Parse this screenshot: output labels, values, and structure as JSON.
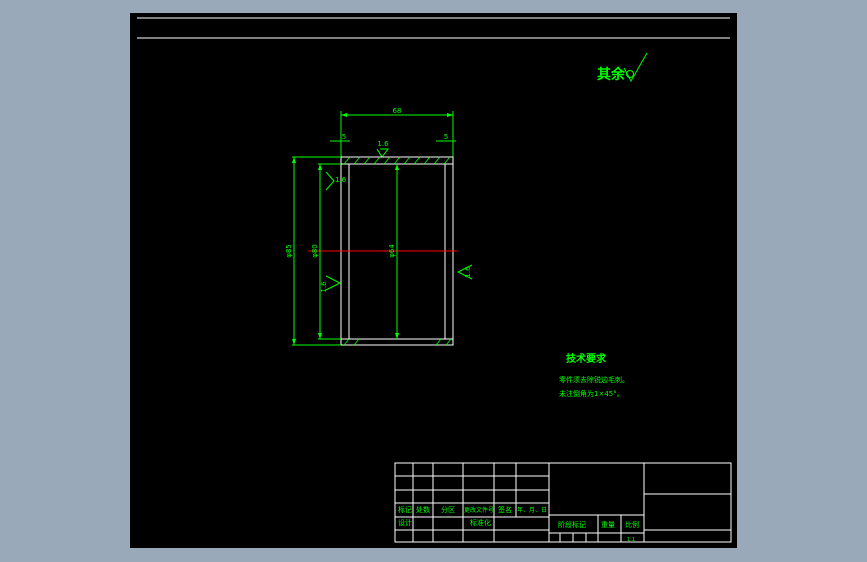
{
  "colors": {
    "background": "#99a9b9",
    "viewport": "#000000",
    "frame": "#ffffff",
    "geometry": "#ffffff",
    "dimension": "#00ff00",
    "centerline": "#ff0000",
    "hatch": "#00ff00"
  },
  "roughness_note": {
    "label": "其余",
    "symbol": "roughness-check-icon"
  },
  "dimensions": {
    "overall_width": "68",
    "left_flange": "5",
    "right_flange": "5",
    "outer_height": "φ85",
    "mid_height": "φ80",
    "bore": "φ64"
  },
  "roughness_marks": {
    "top": "1.6",
    "left_upper": "1.6",
    "left_lower": "1.6",
    "right": "1.6"
  },
  "tech_requirements": {
    "title": "技术要求",
    "lines": [
      "零件须去除锐边毛刺。",
      "未注倒角为1×45°。"
    ]
  },
  "title_block": {
    "labels": {
      "mark": "标记",
      "count": "处数",
      "zone": "分区",
      "doc_no": "更改文件号",
      "sign": "签名",
      "date": "年、月、日",
      "design": "设计",
      "standard": "标准化",
      "stage": "阶段标记",
      "weight": "重量",
      "scale": "比例",
      "scale_value": "1:1"
    }
  }
}
